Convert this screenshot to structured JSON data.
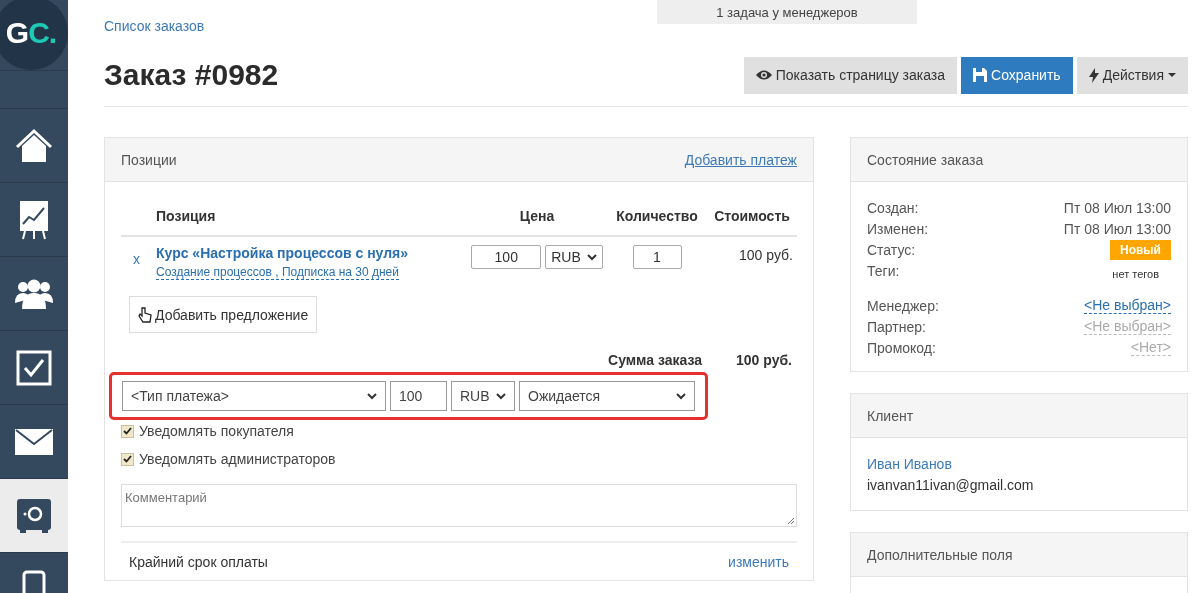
{
  "sidebar": {
    "logo": {
      "first": "G",
      "second": "C."
    },
    "items": [
      {
        "selected": false
      },
      {
        "selected": false
      },
      {
        "selected": false
      },
      {
        "selected": false
      },
      {
        "selected": false
      },
      {
        "selected": true
      },
      {
        "selected": false
      }
    ]
  },
  "top_notice": "1 задача у менеджеров",
  "breadcrumb": "Список заказов",
  "title": "Заказ #0982",
  "actions": [
    {
      "kind": "default",
      "label": "Показать страницу заказа"
    },
    {
      "kind": "primary",
      "label": "Сохранить"
    },
    {
      "kind": "dropdown",
      "label": "Действия"
    }
  ],
  "positions": {
    "title": "Позиции",
    "link": "Добавить платеж",
    "columns": [
      "Позиция",
      "Цена",
      "Количество",
      "Стоимость"
    ],
    "rows": [
      {
        "remove": "x",
        "name": "Курс «Настройка процессов с нуля»",
        "options": "Создание процессов , Подписка на 30 дней",
        "price": "100",
        "currency": "RUB",
        "quantity": "1",
        "cost": "100 руб."
      }
    ],
    "add_offer": "Добавить предложение",
    "total_label": "Сумма заказа",
    "total": "100 руб.",
    "payment": {
      "highlighted": true,
      "type": "<Тип платежа>",
      "amount": "100",
      "currency": "RUB",
      "status": "Ожидается"
    },
    "checkboxes": [
      {
        "label": "Уведомлять покупателя",
        "checked": true
      },
      {
        "label": "Уведомлять администраторов",
        "checked": true
      }
    ],
    "comment": {
      "placeholder": "Комментарий"
    },
    "deadline": {
      "label": "Крайний срок оплаты",
      "link": "изменить"
    }
  },
  "order_state": {
    "title": "Состояние заказа",
    "rows": [
      {
        "kind": "text",
        "label": "Создан:",
        "value": "Пт 08 Июл 13:00"
      },
      {
        "kind": "text",
        "label": "Изменен:",
        "value": "Пт 08 Июл 13:00"
      },
      {
        "kind": "badge",
        "label": "Статус:",
        "value": "Новый"
      },
      {
        "kind": "note",
        "label": "Теги:",
        "value": "нет тегов"
      }
    ],
    "assign_rows": [
      {
        "kind": "link",
        "label": "Менеджер:",
        "value": "<Не выбран>"
      },
      {
        "kind": "muted",
        "label": "Партнер:",
        "value": "<Не выбран>"
      },
      {
        "kind": "muted",
        "label": "Промокод:",
        "value": "<Нет>"
      }
    ]
  },
  "client": {
    "title": "Клиент",
    "name": "Иван Иванов",
    "email": "ivanvan11ivan@gmail.com"
  },
  "extra_fields": {
    "title": "Дополнительные поля"
  }
}
